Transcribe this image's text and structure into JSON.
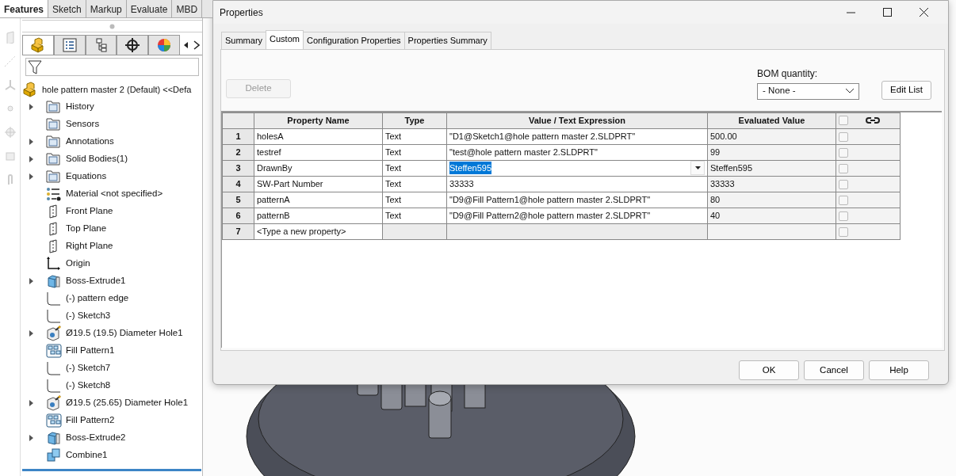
{
  "command_tabs": [
    {
      "label": "Features",
      "selected": true
    },
    {
      "label": "Sketch",
      "selected": false
    },
    {
      "label": "Markup",
      "selected": false
    },
    {
      "label": "Evaluate",
      "selected": false
    },
    {
      "label": "MBD",
      "selected": false
    }
  ],
  "feature_manager": {
    "tabs": [
      {
        "kind": "part",
        "selected": true
      },
      {
        "kind": "property",
        "selected": false
      },
      {
        "kind": "config",
        "selected": false
      },
      {
        "kind": "dimxpert",
        "selected": false
      },
      {
        "kind": "display",
        "selected": false
      }
    ],
    "root": "hole pattern master 2 (Default) <<Defa",
    "tree": [
      {
        "label": "History",
        "kind": "folder",
        "expandable": true
      },
      {
        "label": "Sensors",
        "kind": "folder",
        "expandable": false
      },
      {
        "label": "Annotations",
        "kind": "folder",
        "expandable": true
      },
      {
        "label": "Solid Bodies(1)",
        "kind": "folder",
        "expandable": true
      },
      {
        "label": "Equations",
        "kind": "folder",
        "expandable": true
      },
      {
        "label": "Material <not specified>",
        "kind": "material",
        "expandable": false
      },
      {
        "label": "Front Plane",
        "kind": "plane",
        "expandable": false
      },
      {
        "label": "Top Plane",
        "kind": "plane",
        "expandable": false
      },
      {
        "label": "Right Plane",
        "kind": "plane",
        "expandable": false
      },
      {
        "label": "Origin",
        "kind": "origin",
        "expandable": false
      },
      {
        "label": "Boss-Extrude1",
        "kind": "extrude",
        "expandable": true
      },
      {
        "label": "(-) pattern edge",
        "kind": "sketch",
        "expandable": false
      },
      {
        "label": "(-) Sketch3",
        "kind": "sketch",
        "expandable": false
      },
      {
        "label": "Ø19.5 (19.5) Diameter Hole1",
        "kind": "hole",
        "expandable": true
      },
      {
        "label": "Fill Pattern1",
        "kind": "pattern",
        "expandable": false
      },
      {
        "label": "(-) Sketch7",
        "kind": "sketch",
        "expandable": false
      },
      {
        "label": "(-) Sketch8",
        "kind": "sketch",
        "expandable": false
      },
      {
        "label": "Ø19.5 (25.65) Diameter Hole1",
        "kind": "hole",
        "expandable": true
      },
      {
        "label": "Fill Pattern2",
        "kind": "pattern",
        "expandable": false
      },
      {
        "label": "Boss-Extrude2",
        "kind": "extrude",
        "expandable": true
      },
      {
        "label": "Combine1",
        "kind": "combine",
        "expandable": false
      }
    ]
  },
  "dialog": {
    "title": "Properties",
    "tabs": [
      {
        "label": "Summary",
        "selected": false
      },
      {
        "label": "Custom",
        "selected": true
      },
      {
        "label": "Configuration Properties",
        "selected": false
      },
      {
        "label": "Properties Summary",
        "selected": false
      }
    ],
    "delete_button": {
      "label": "Delete",
      "disabled": true
    },
    "bom_quantity": {
      "label": "BOM quantity:",
      "value": "- None -"
    },
    "edit_list_button": "Edit List",
    "table": {
      "columns": [
        "Property Name",
        "Type",
        "Value / Text Expression",
        "Evaluated Value"
      ],
      "header_checked": false,
      "rows": [
        {
          "number": "1",
          "name": "holesA",
          "type": "Text",
          "value": "\"D1@Sketch1@hole pattern master 2.SLDPRT\"",
          "evaluated": "500.00",
          "editing": false,
          "checked": false
        },
        {
          "number": "2",
          "name": "testref",
          "type": "Text",
          "value": "\"test@hole pattern master 2.SLDPRT\"",
          "evaluated": "99",
          "editing": false,
          "checked": false
        },
        {
          "number": "3",
          "name": "DrawnBy",
          "type": "Text",
          "value": "Steffen595",
          "evaluated": "Steffen595",
          "editing": true,
          "checked": false
        },
        {
          "number": "4",
          "name": "SW-Part Number",
          "type": "Text",
          "value": "33333",
          "evaluated": "33333",
          "editing": false,
          "checked": false
        },
        {
          "number": "5",
          "name": "patternA",
          "type": "Text",
          "value": "\"D9@Fill Pattern1@hole pattern master 2.SLDPRT\"",
          "evaluated": "80",
          "editing": false,
          "checked": false
        },
        {
          "number": "6",
          "name": "patternB",
          "type": "Text",
          "value": "\"D9@Fill Pattern2@hole pattern master 2.SLDPRT\"",
          "evaluated": "40",
          "editing": false,
          "checked": false
        },
        {
          "number": "7",
          "name": "<Type a new property>",
          "kind": "new",
          "editing": false,
          "checked": false
        }
      ]
    },
    "buttons": [
      "OK",
      "Cancel",
      "Help"
    ]
  }
}
